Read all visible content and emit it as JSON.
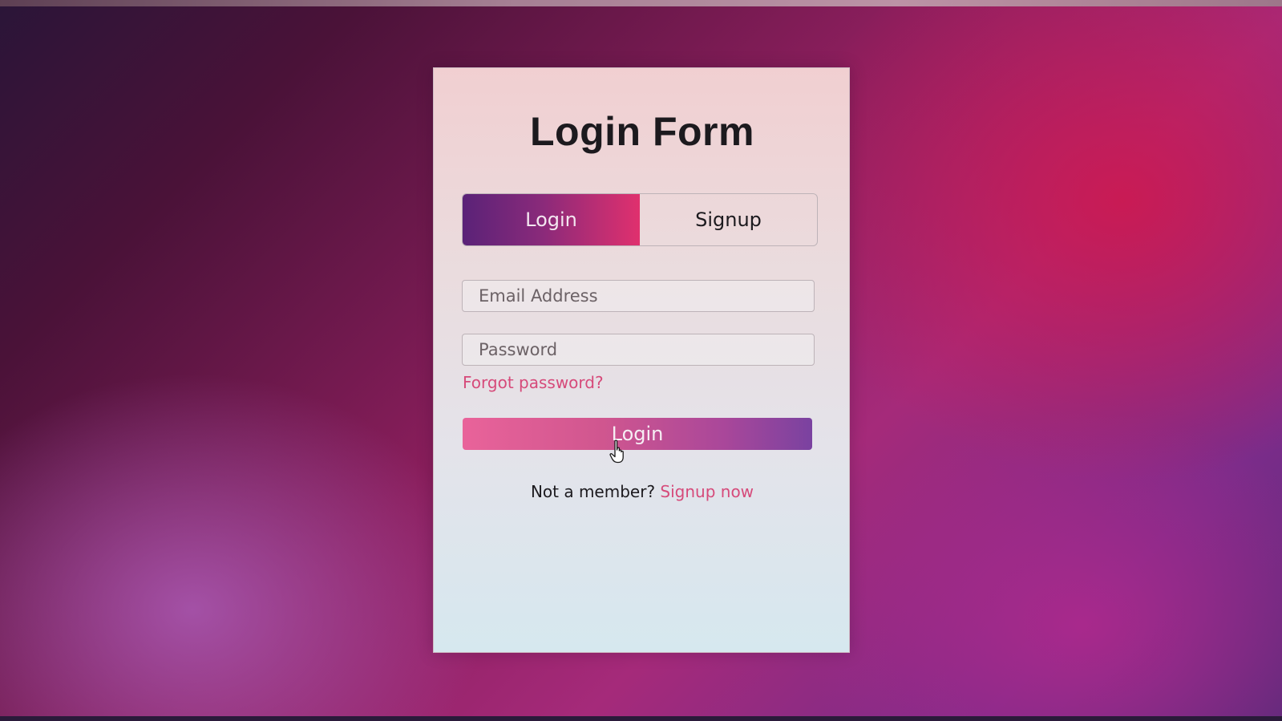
{
  "form": {
    "title": "Login Form",
    "tabs": [
      {
        "label": "Login",
        "active": true
      },
      {
        "label": "Signup",
        "active": false
      }
    ],
    "email": {
      "placeholder": "Email Address",
      "value": ""
    },
    "password": {
      "placeholder": "Password",
      "value": ""
    },
    "forgot_label": "Forgot password?",
    "submit_label": "Login",
    "footer_text": "Not a member?",
    "footer_link": "Signup now"
  },
  "colors": {
    "accent_pink": "#d64a7a",
    "tab_gradient_start": "#5a2278",
    "tab_gradient_end": "#e0306e",
    "button_gradient_start": "#e9639a",
    "button_gradient_end": "#7a42a0"
  },
  "icons": {
    "cursor": "hand-pointer-cursor-icon"
  }
}
